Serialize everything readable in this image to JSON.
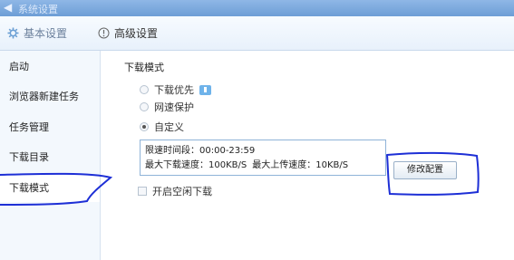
{
  "window": {
    "title": "系统设置"
  },
  "tabs": [
    {
      "label": "基本设置",
      "icon": "gear-icon"
    },
    {
      "label": "高级设置",
      "icon": "info-circle-icon"
    }
  ],
  "sidebar": {
    "items": [
      {
        "label": "启动"
      },
      {
        "label": "浏览器新建任务"
      },
      {
        "label": "任务管理"
      },
      {
        "label": "下载目录"
      },
      {
        "label": "下载模式"
      }
    ],
    "active": "下载模式"
  },
  "content": {
    "section_title": "下载模式",
    "options": [
      {
        "label": "下载优先",
        "checked": false
      },
      {
        "label": "网速保护",
        "checked": false
      },
      {
        "label": "自定义",
        "checked": true
      }
    ],
    "limit": {
      "time_label": "限速时间段：",
      "time_value": "00:00-23:59",
      "max_download_label": "最大下载速度：",
      "max_download_value": "100KB/S",
      "max_upload_label": "最大上传速度：",
      "max_upload_value": "10KB/S"
    },
    "modify_button": "修改配置",
    "idle_download_label": "开启空闲下载",
    "idle_download_checked": false
  },
  "colors": {
    "annotation_stroke": "#1d2fd6",
    "accent": "#6d9ed6"
  }
}
